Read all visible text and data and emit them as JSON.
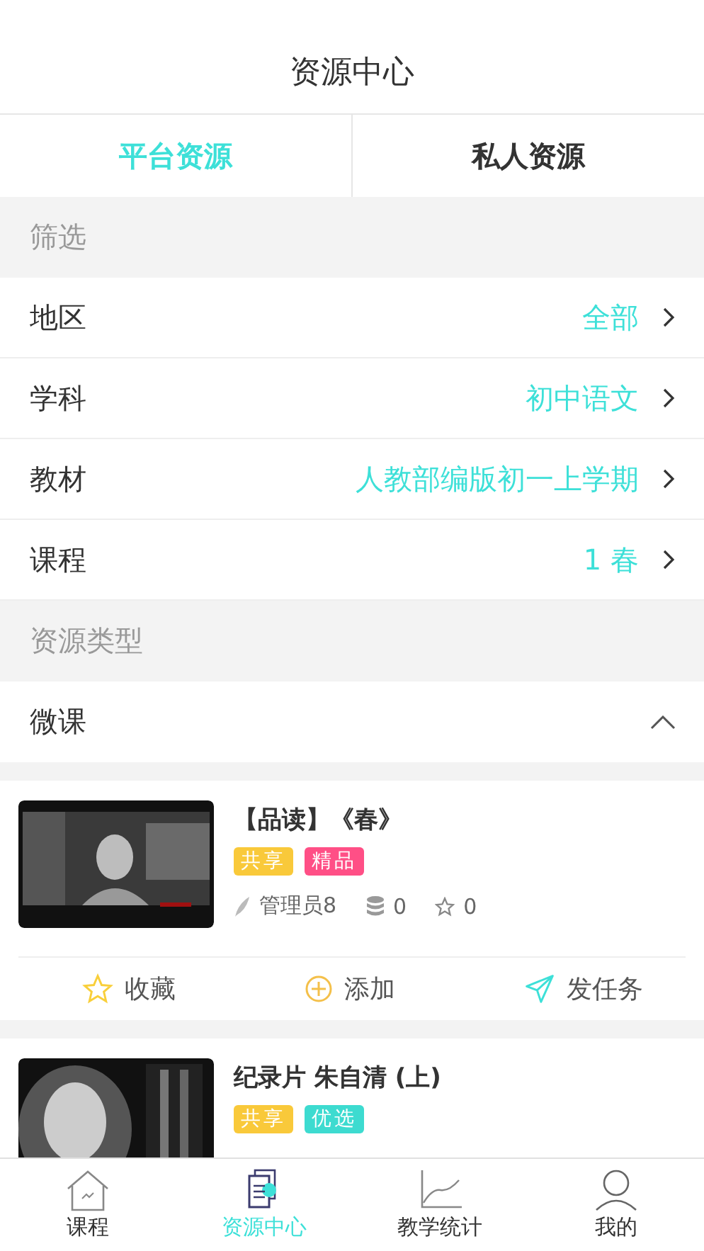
{
  "header": {
    "title": "资源中心"
  },
  "tabs": [
    {
      "label": "平台资源",
      "selected": true
    },
    {
      "label": "私人资源",
      "selected": false
    }
  ],
  "filter_section": {
    "title": "筛选"
  },
  "filters": [
    {
      "label": "地区",
      "value": "全部"
    },
    {
      "label": "学科",
      "value": "初中语文"
    },
    {
      "label": "教材",
      "value": "人教部编版初一上学期"
    },
    {
      "label": "课程",
      "value": "1 春"
    }
  ],
  "type_section": {
    "title": "资源类型"
  },
  "type_group": {
    "label": "微课",
    "expanded": true
  },
  "resources": [
    {
      "title": "【品读】《春》",
      "tags": [
        {
          "label": "共享",
          "color": "#f9c93a"
        },
        {
          "label": "精品",
          "color": "#ff4f86"
        }
      ],
      "author": "管理员8",
      "downloads": "0",
      "favorites": "0",
      "actions": [
        {
          "kind": "favorite",
          "label": "收藏"
        },
        {
          "kind": "add",
          "label": "添加"
        },
        {
          "kind": "task",
          "label": "发任务"
        }
      ]
    },
    {
      "title": "纪录片 朱自清 (上)",
      "tags": [
        {
          "label": "共享",
          "color": "#f9c93a"
        },
        {
          "label": "优选",
          "color": "#3ddbd0"
        }
      ]
    }
  ],
  "bottom_nav": [
    {
      "kind": "home",
      "label": "课程",
      "selected": false
    },
    {
      "kind": "docs",
      "label": "资源中心",
      "selected": true
    },
    {
      "kind": "chart",
      "label": "教学统计",
      "selected": false
    },
    {
      "kind": "user",
      "label": "我的",
      "selected": false
    }
  ]
}
